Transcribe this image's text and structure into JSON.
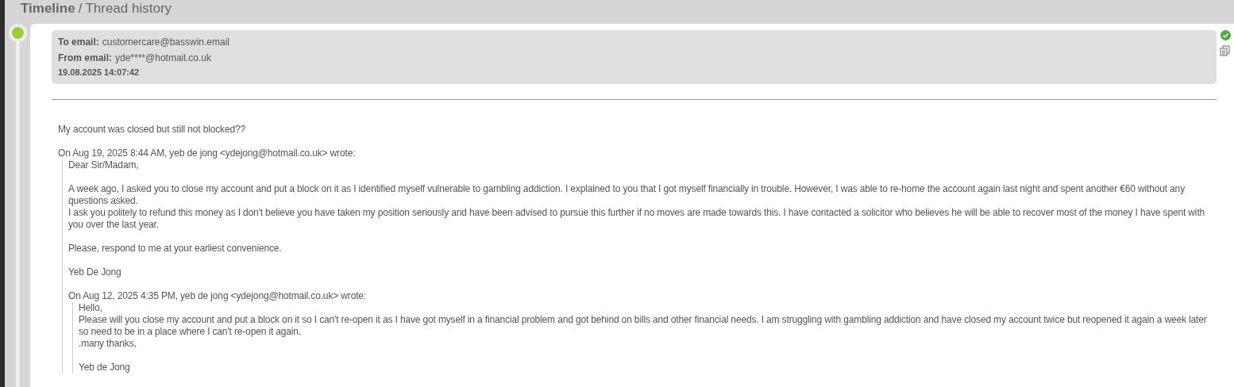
{
  "breadcrumb": {
    "section": "Timeline",
    "separator": "/",
    "page": "Thread history"
  },
  "message": {
    "header": [
      {
        "kind": "field",
        "label": "To email:",
        "value": "customercare@basswin.email"
      },
      {
        "kind": "field",
        "label": "From email:",
        "value": "yde****@hotmail.co.uk"
      },
      {
        "kind": "date",
        "value": "19.08.2025 14:07:42"
      }
    ],
    "body": [
      {
        "kind": "paragraph",
        "lines": [
          "My account was closed but still not blocked??"
        ]
      },
      {
        "kind": "paragraph",
        "lines": [
          "On Aug 19, 2025 8:44 AM, yeb de jong <ydejong@hotmail.co.uk> wrote:"
        ]
      },
      {
        "kind": "quote",
        "content": [
          {
            "kind": "paragraph",
            "lines": [
              "Dear Sir/Madam,"
            ]
          },
          {
            "kind": "paragraph",
            "lines": [
              "A week ago, I asked you to close my account and put a block on it as I identified myself vulnerable to gambling addiction. I explained to you that I got myself financially in trouble. However, I was able to re-home the account again last night and spent another €60 without any questions asked.",
              "I ask you politely to refund this money as I don't believe you have taken my position seriously and have been advised to pursue this further if no moves are made towards this. I have contacted a solicitor who believes he will be able to recover most of the money I have spent with you over the last year."
            ]
          },
          {
            "kind": "paragraph",
            "lines": [
              "Please, respond to me at your earliest convenience."
            ]
          },
          {
            "kind": "paragraph",
            "lines": [
              "Yeb De Jong"
            ]
          },
          {
            "kind": "paragraph",
            "lines": [
              "On Aug 12, 2025 4:35 PM, yeb de jong <ydejong@hotmail.co.uk> wrote:"
            ]
          },
          {
            "kind": "quote",
            "content": [
              {
                "kind": "paragraph",
                "lines": [
                  "Hello,",
                  "Please will you close my account and put a block on it so I can't re-open it as I have got myself in a financial problem and got behind on bills and other financial needs. I am struggling with gambling addiction and have closed my account twice but reopened it again a week later so need to be in a place where I can't re-open it again.",
                  ".many thanks,"
                ]
              },
              {
                "kind": "paragraph",
                "lines": [
                  "Yeb de Jong"
                ]
              }
            ]
          }
        ]
      }
    ]
  }
}
